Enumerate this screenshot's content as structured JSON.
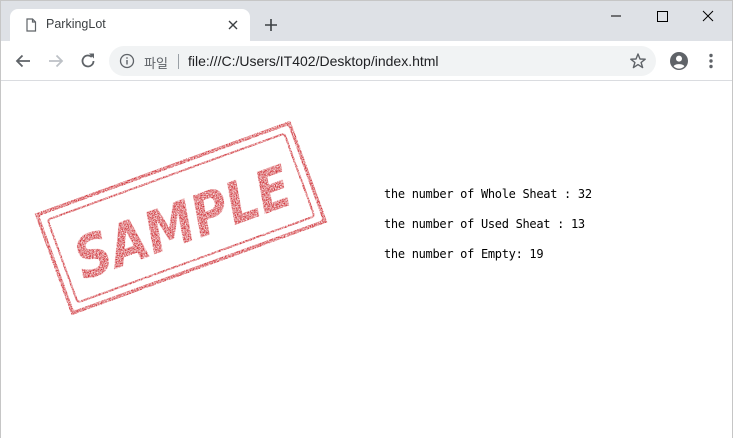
{
  "tab": {
    "title": "ParkingLot"
  },
  "omnibox": {
    "security_label": "파일",
    "url": "file:///C:/Users/IT402/Desktop/index.html"
  },
  "content": {
    "sample_stamp_text": "SAMPLE",
    "stats": [
      "the number of Whole Sheat : 32",
      "the number of Used Sheat : 13",
      "the number of Empty: 19"
    ]
  },
  "colors": {
    "stamp_red": "#c8171e",
    "tabstrip_bg": "#dee1e6",
    "omnibox_bg": "#f1f3f4"
  }
}
